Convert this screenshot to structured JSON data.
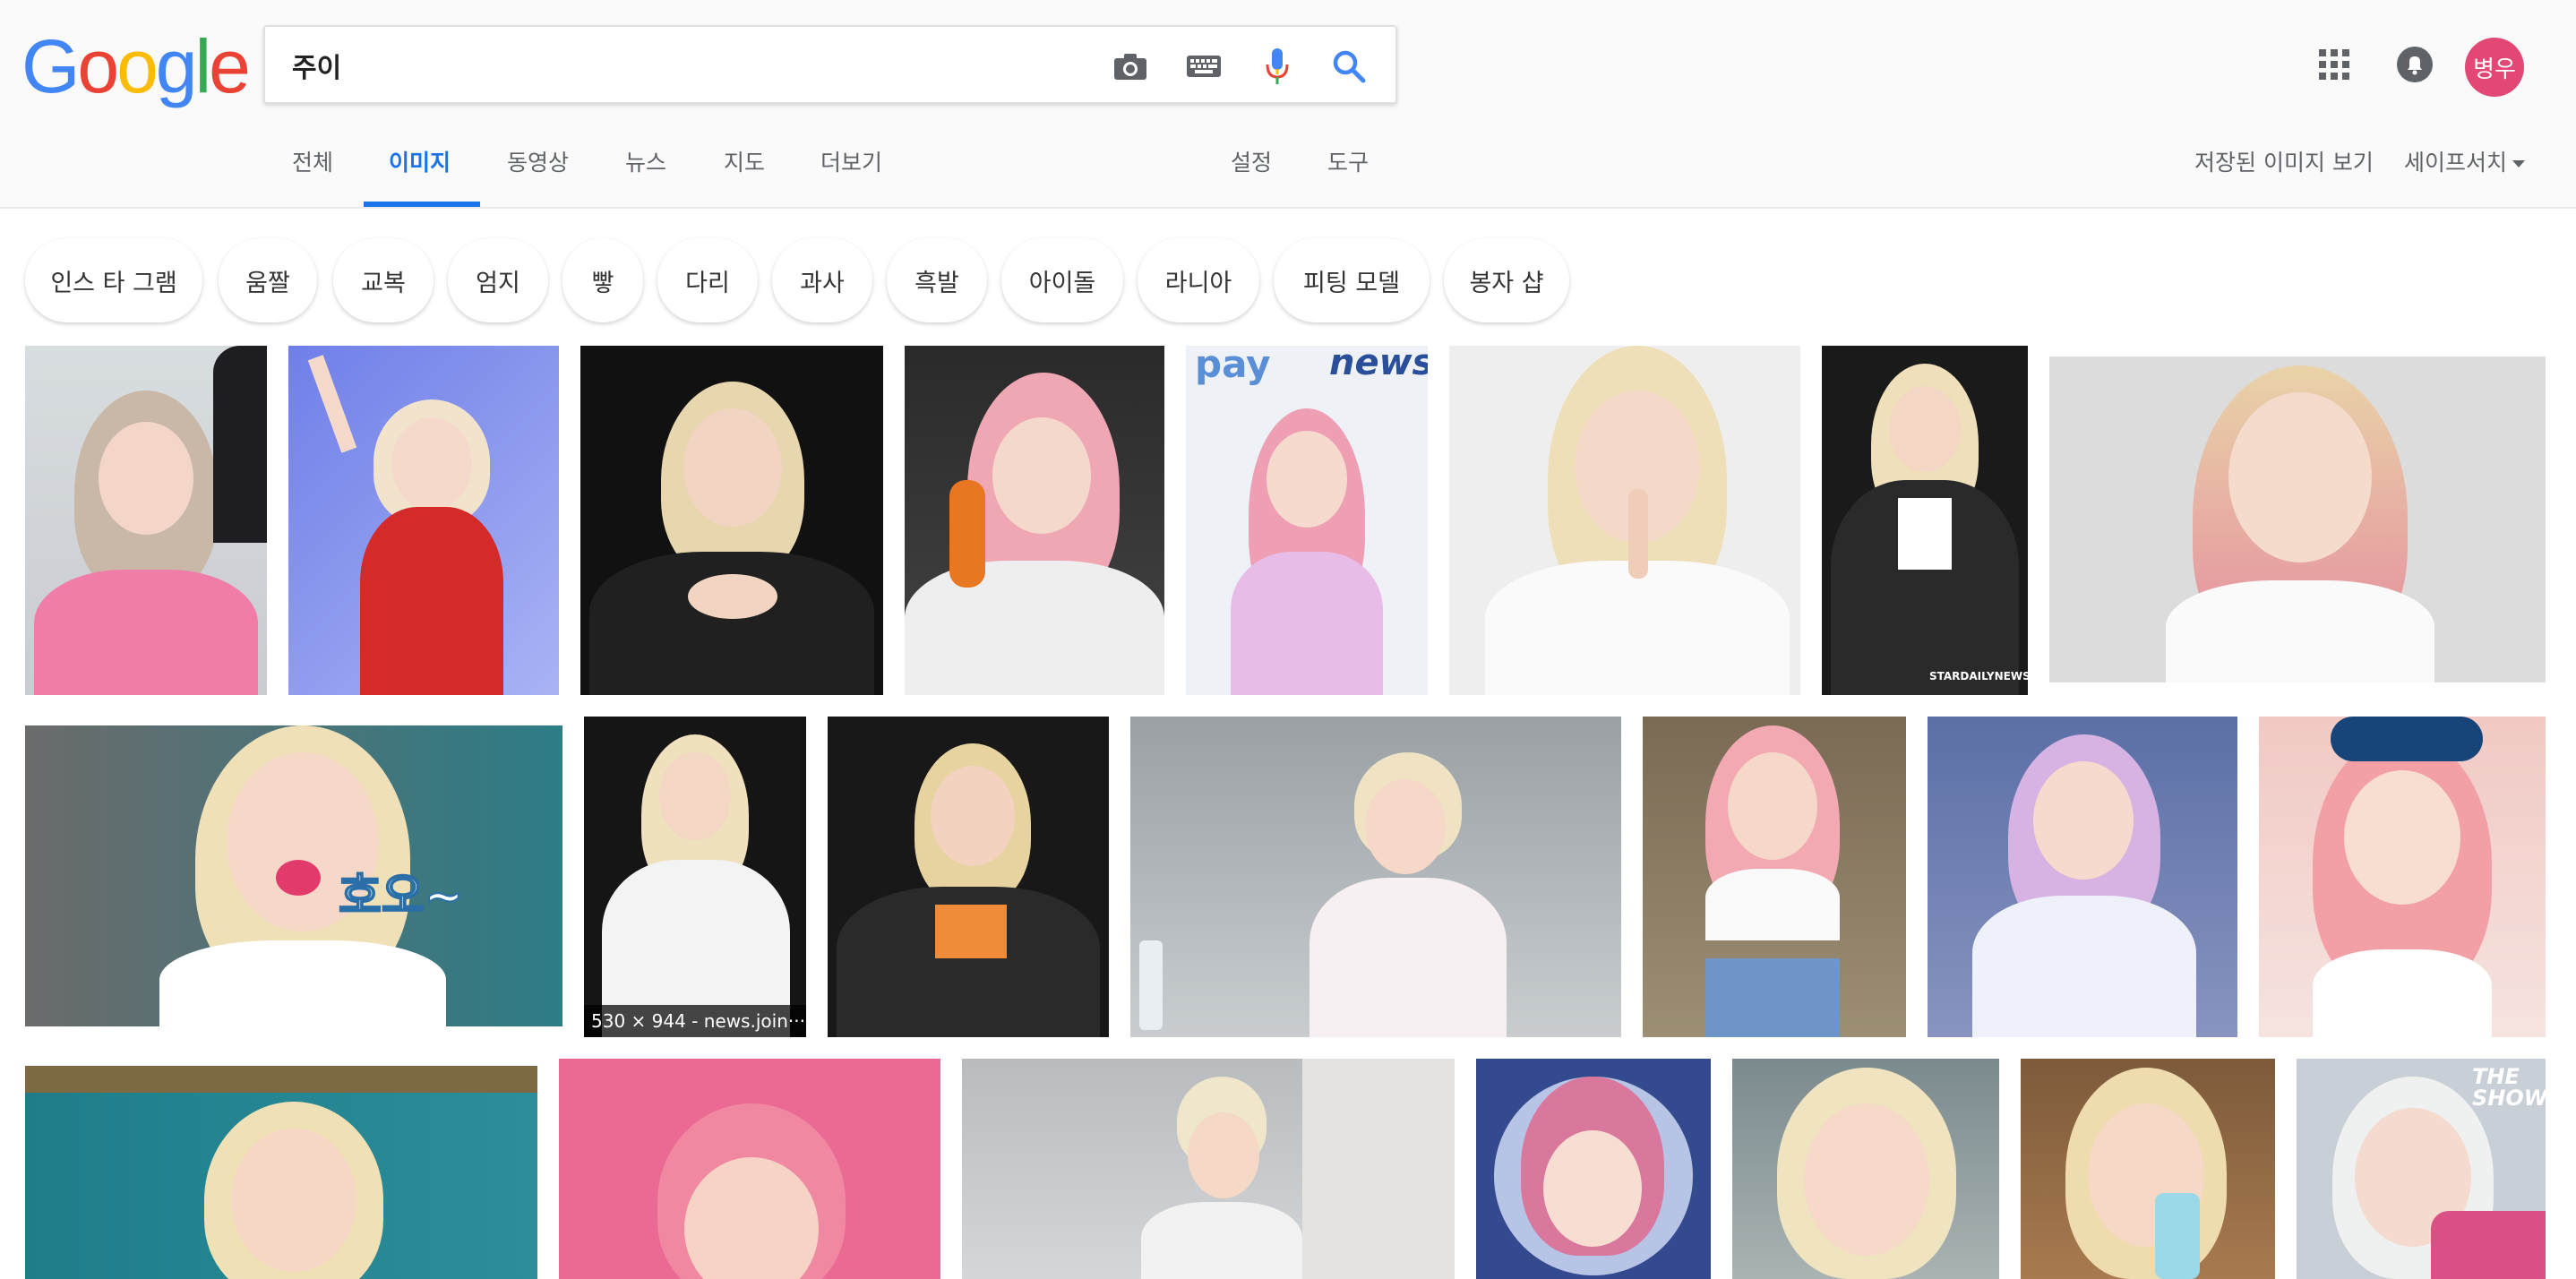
{
  "logo": {
    "text": "Google",
    "letters": [
      {
        "ch": "G",
        "color": "#4285F4"
      },
      {
        "ch": "o",
        "color": "#EA4335"
      },
      {
        "ch": "o",
        "color": "#FBBC05"
      },
      {
        "ch": "g",
        "color": "#4285F4"
      },
      {
        "ch": "l",
        "color": "#34A853"
      },
      {
        "ch": "e",
        "color": "#EA4335"
      }
    ]
  },
  "search": {
    "query": "주이"
  },
  "user": {
    "avatar_label": "병우",
    "avatar_color": "#e34775"
  },
  "tabs": [
    {
      "label": "전체",
      "active": false
    },
    {
      "label": "이미지",
      "active": true
    },
    {
      "label": "동영상",
      "active": false
    },
    {
      "label": "뉴스",
      "active": false
    },
    {
      "label": "지도",
      "active": false
    },
    {
      "label": "더보기",
      "active": false
    }
  ],
  "tools": {
    "settings": "설정",
    "tools": "도구"
  },
  "right_links": {
    "saved_images": "저장된 이미지 보기",
    "safesearch": "세이프서치"
  },
  "chips": [
    "인스 타 그램",
    "움짤",
    "교복",
    "엄지",
    "빻",
    "다리",
    "과사",
    "흑발",
    "아이돌",
    "라니아",
    "피팅 모델",
    "봉자 샵"
  ],
  "images": {
    "hover_caption": "530 × 944 - news.join···",
    "overlay_texts": {
      "pay": "pay",
      "news": "news",
      "stardaily": "STARDAILYNEWS",
      "hooh": "호오~",
      "theshow": "THE SHOW"
    }
  },
  "colors": {
    "accent": "#1a73e8",
    "tab_text": "#5f6368"
  }
}
